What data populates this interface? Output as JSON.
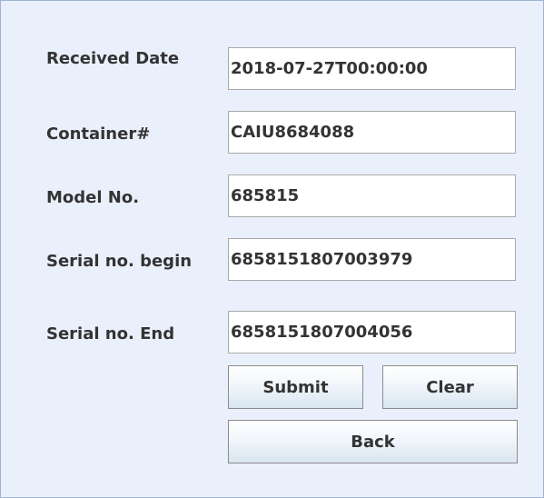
{
  "form": {
    "received_date": {
      "label": "Received Date",
      "value": "2018-07-27T00:00:00"
    },
    "container": {
      "label": "Container#",
      "value": "CAIU8684088"
    },
    "model_no": {
      "label": "Model No.",
      "value": "685815"
    },
    "serial_begin": {
      "label": "Serial no. begin",
      "value": "6858151807003979"
    },
    "serial_end": {
      "label": "Serial no. End",
      "value": "6858151807004056"
    }
  },
  "buttons": {
    "submit": "Submit",
    "clear": "Clear",
    "back": "Back"
  },
  "colors": {
    "panel_background": "#eaf0fb",
    "text": "#333333",
    "button_gradient_bottom": "#d9e6f1"
  }
}
